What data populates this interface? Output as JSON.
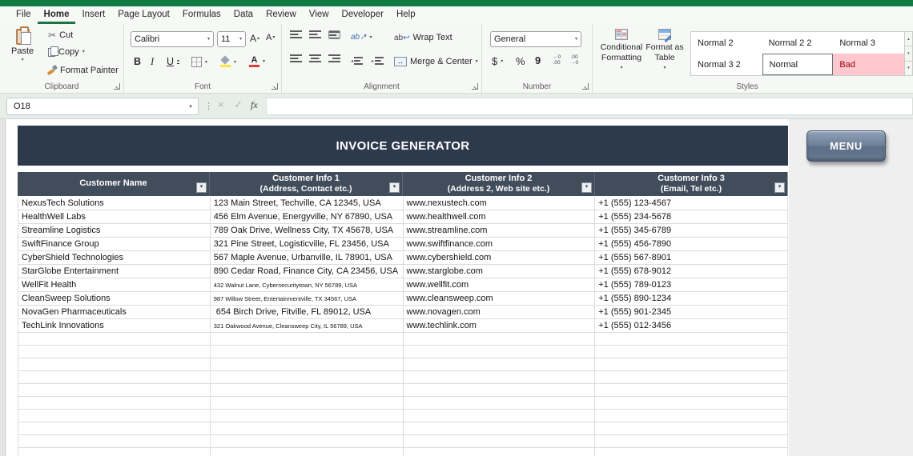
{
  "menu_tabs": {
    "items": [
      "File",
      "Home",
      "Insert",
      "Page Layout",
      "Formulas",
      "Data",
      "Review",
      "View",
      "Developer",
      "Help"
    ],
    "active": "Home"
  },
  "ribbon": {
    "clipboard": {
      "label": "Clipboard",
      "paste": "Paste",
      "cut": "Cut",
      "copy": "Copy",
      "format_painter": "Format Painter"
    },
    "font": {
      "label": "Font",
      "family": "Calibri",
      "size": "11",
      "bold": "B",
      "italic": "I",
      "underline": "U"
    },
    "alignment": {
      "label": "Alignment",
      "wrap_text": "Wrap Text",
      "merge_center": "Merge & Center"
    },
    "number": {
      "label": "Number",
      "format": "General",
      "currency": "$",
      "percent": "%",
      "comma": "9"
    },
    "styles": {
      "label": "Styles",
      "conditional_formatting": "Conditional Formatting",
      "format_as_table": "Format as Table",
      "gallery": [
        "Normal 2",
        "Normal 2 2",
        "Normal 3",
        "Normal 3 2",
        "Normal",
        "Bad"
      ],
      "selected": "Normal",
      "bad_style": "Bad"
    }
  },
  "formula_bar": {
    "name_box": "O18",
    "fx_label": "fx",
    "formula_value": ""
  },
  "icons": {
    "dropdown": "▾",
    "cancel": "×",
    "enter": "✓",
    "dots": "⋮",
    "scissors": "✂",
    "size_up": "▴",
    "size_down": "▾",
    "wrap_arrow": "↩",
    "merge_arrows": "↔",
    "orientation": "ab",
    "wrap_ab": "ab",
    "indent_left": "◂",
    "indent_right": "▸",
    "dec_arrow_left": "←",
    "dec_arrow_right": "→"
  },
  "sheet": {
    "banner_title": "INVOICE GENERATOR",
    "menu_button": "MENU",
    "columns": [
      {
        "title": "Customer Name",
        "subtitle": ""
      },
      {
        "title": "Customer Info 1",
        "subtitle": "(Address, Contact etc.)"
      },
      {
        "title": "Customer Info 2",
        "subtitle": "(Address 2, Web site etc.)"
      },
      {
        "title": "Customer Info 3",
        "subtitle": "(Email, Tel etc.)"
      }
    ],
    "rows": [
      {
        "name": "NexusTech Solutions",
        "address": "123 Main Street, Techville, CA 12345, USA",
        "website": "www.nexustech.com",
        "phone": "+1 (555) 123-4567",
        "small_address": false
      },
      {
        "name": "HealthWell Labs",
        "address": "456 Elm Avenue, Energyville, NY 67890, USA",
        "website": "www.healthwell.com",
        "phone": "+1 (555) 234-5678",
        "small_address": false
      },
      {
        "name": "Streamline Logistics",
        "address": "789 Oak Drive, Wellness City, TX 45678, USA",
        "website": "www.streamline.com",
        "phone": "+1 (555) 345-6789",
        "small_address": false
      },
      {
        "name": "SwiftFinance Group",
        "address": "321 Pine Street, Logisticville, FL 23456, USA",
        "website": "www.swiftfinance.com",
        "phone": "+1 (555) 456-7890",
        "small_address": false
      },
      {
        "name": "CyberShield Technologies",
        "address": "567 Maple Avenue, Urbanville, IL 78901, USA",
        "website": "www.cybershield.com",
        "phone": "+1 (555) 567-8901",
        "small_address": false
      },
      {
        "name": "StarGlobe Entertainment",
        "address": "890 Cedar Road, Finance City, CA 23456, USA",
        "website": "www.starglobe.com",
        "phone": "+1 (555) 678-9012",
        "small_address": false
      },
      {
        "name": "WellFit Health",
        "address": "432 Walnut Lane, Cybersecuritytown, NY 56789, USA",
        "website": "www.wellfit.com",
        "phone": "+1 (555) 789-0123",
        "small_address": true
      },
      {
        "name": "CleanSweep Solutions",
        "address": "987 Willow Street, Entertainmentville, TX 34567, USA",
        "website": "www.cleansweep.com",
        "phone": "+1 (555) 890-1234",
        "small_address": true
      },
      {
        "name": "NovaGen Pharmaceuticals",
        "address": " 654 Birch Drive, Fitville, FL 89012, USA",
        "website": "www.novagen.com",
        "phone": "+1 (555) 901-2345",
        "small_address": false
      },
      {
        "name": "TechLink Innovations",
        "address": "321 Oakwood Avenue, Cleansweep City, IL 56789, USA",
        "website": "www.techlink.com",
        "phone": "+1 (555) 012-3456",
        "small_address": true
      }
    ],
    "empty_row_count": 10
  },
  "colors": {
    "titlebar_green": "#107c41",
    "tab_accent_green": "#1e7145",
    "banner_navy": "#2c3a4c",
    "table_header": "#424d5c",
    "bad_style_bg": "#ffc7ce",
    "bad_style_text": "#9c0006",
    "menu_button_top": "#91a3b9",
    "menu_button_bottom": "#5c6f87"
  }
}
